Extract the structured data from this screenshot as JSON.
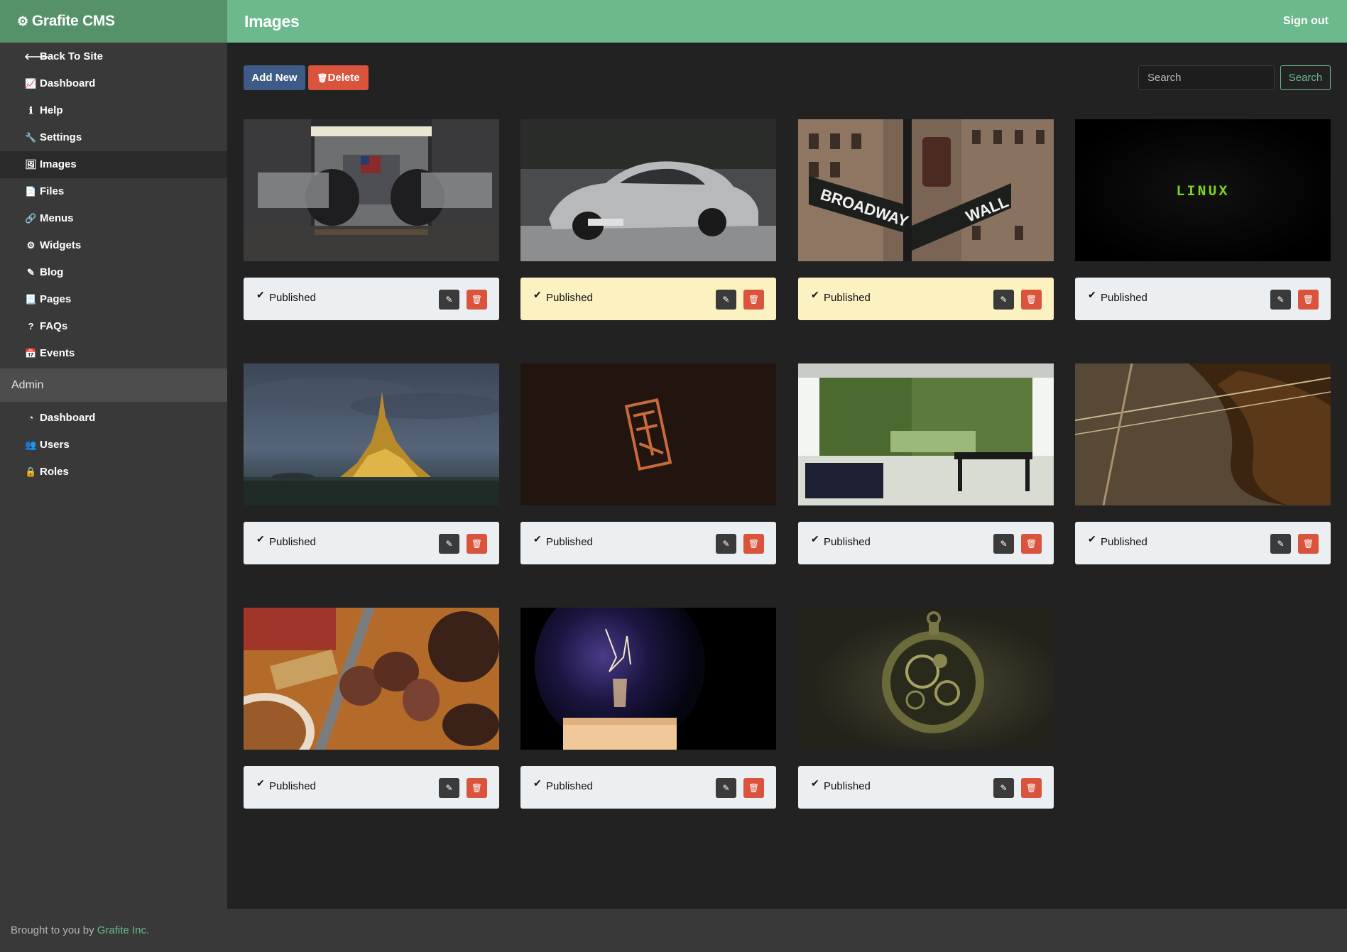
{
  "brand": {
    "name": "Grafite CMS",
    "icon": "gears-icon"
  },
  "header": {
    "title": "Images",
    "signout": "Sign out"
  },
  "sidebar": {
    "items": [
      {
        "label": "Back To Site",
        "icon": "arrow-left-icon",
        "glyph": "🡐"
      },
      {
        "label": "Dashboard",
        "icon": "line-chart-icon",
        "glyph": "📈"
      },
      {
        "label": "Help",
        "icon": "info-icon",
        "glyph": "ℹ"
      },
      {
        "label": "Settings",
        "icon": "wrench-icon",
        "glyph": "🔧"
      },
      {
        "label": "Images",
        "icon": "image-icon",
        "glyph": "🖼"
      },
      {
        "label": "Files",
        "icon": "file-icon",
        "glyph": "📄"
      },
      {
        "label": "Menus",
        "icon": "link-icon",
        "glyph": "🔗"
      },
      {
        "label": "Widgets",
        "icon": "cog-icon",
        "glyph": "⚙"
      },
      {
        "label": "Blog",
        "icon": "pencil-icon",
        "glyph": "✎"
      },
      {
        "label": "Pages",
        "icon": "file-text-icon",
        "glyph": "📃"
      },
      {
        "label": "FAQs",
        "icon": "question-icon",
        "glyph": "?"
      },
      {
        "label": "Events",
        "icon": "calendar-icon",
        "glyph": "📅"
      }
    ],
    "section": "Admin",
    "admin_items": [
      {
        "label": "Dashboard",
        "icon": "tachometer-icon",
        "glyph": "◔"
      },
      {
        "label": "Users",
        "icon": "users-icon",
        "glyph": "👥"
      },
      {
        "label": "Roles",
        "icon": "lock-icon",
        "glyph": "🔒"
      }
    ],
    "active": "Images"
  },
  "toolbar": {
    "add_label": "Add New",
    "delete_label": "Delete",
    "search_placeholder": "Search",
    "search_button": "Search"
  },
  "images": [
    {
      "subject": "rocket hangar",
      "status": "Published",
      "highlight": false
    },
    {
      "subject": "silver sports car",
      "status": "Published",
      "highlight": true
    },
    {
      "subject": "Broadway / Wall St sign",
      "status": "Published",
      "highlight": true
    },
    {
      "subject": "linux logo",
      "status": "Published",
      "highlight": false
    },
    {
      "subject": "castle on island at dusk",
      "status": "Published",
      "highlight": false
    },
    {
      "subject": "hack logo on dark background",
      "status": "Published",
      "highlight": false
    },
    {
      "subject": "modern living room with garden",
      "status": "Published",
      "highlight": false
    },
    {
      "subject": "violin close-up",
      "status": "Published",
      "highlight": false
    },
    {
      "subject": "sliced steak with knife",
      "status": "Published",
      "highlight": false
    },
    {
      "subject": "glowing light bulb",
      "status": "Published",
      "highlight": false
    },
    {
      "subject": "pocket watch mechanism",
      "status": "Published",
      "highlight": false
    }
  ],
  "footer": {
    "text": "Brought to you by ",
    "link": "Grafite Inc."
  },
  "colors": {
    "brand_green": "#55926a",
    "topbar_green": "#6bb98c",
    "sidebar": "#393939",
    "main_bg": "#222222",
    "primary": "#3e5a86",
    "danger": "#d9533d",
    "highlight": "#fbf1c1"
  }
}
